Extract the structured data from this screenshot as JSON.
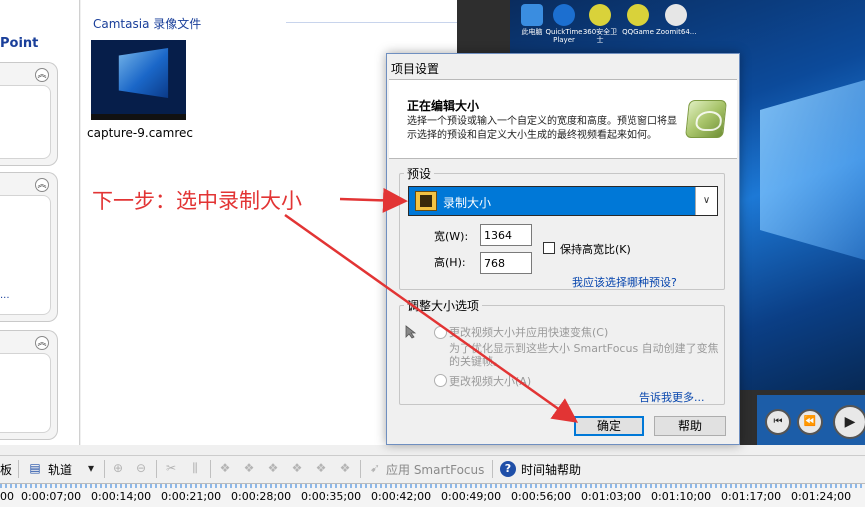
{
  "left_panel": {
    "title_fragment": "Point",
    "more_dots": "..."
  },
  "clip_bin": {
    "title": "Camtasia 录像文件",
    "clip_label": "capture-9.camrec"
  },
  "desktop_icons": [
    {
      "label": "此电脑"
    },
    {
      "label": "QuickTime Player"
    },
    {
      "label": "360安全卫士"
    },
    {
      "label": "QQGame"
    },
    {
      "label": "Zoomit64..."
    }
  ],
  "dialog": {
    "title": "项目设置",
    "header_title": "正在编辑大小",
    "header_desc": "选择一个预设或输入一个自定义的宽度和高度。预览窗口将显示选择的预设和自定义大小生成的最终视频看起来如何。",
    "preset_group": "预设",
    "preset_value": "录制大小",
    "width_label": "宽(W):",
    "width_value": "1364",
    "height_label": "高(H):",
    "height_value": "768",
    "keep_ratio_label": "保持高宽比(K)",
    "which_preset_link": "我应该选择哪种预设?",
    "adjust_group": "调整大小选项",
    "option_smartfocus": "更改视频大小并应用快速变焦(C)",
    "option_smartfocus_desc": "为了优化显示到这些大小 SmartFocus 自动创建了变焦的关键帧。",
    "option_resize": "更改视频大小(A)",
    "tell_more_link": "告诉我更多...",
    "ok_button": "确定",
    "help_button": "帮助"
  },
  "annotation": {
    "text": "下一步：选中录制大小"
  },
  "toolbar": {
    "left_fragment": "板",
    "track_label": "轨道",
    "apply_smartfocus": "应用 SmartFocus",
    "timeline_help": "时间轴帮助"
  },
  "ruler_ticks": [
    "00",
    "0:00:07;00",
    "0:00:14;00",
    "0:00:21;00",
    "0:00:28;00",
    "0:00:35;00",
    "0:00:42;00",
    "0:00:49;00",
    "0:00:56;00",
    "0:01:03;00",
    "0:01:10;00",
    "0:01:17;00",
    "0:01:24;00"
  ],
  "colors": {
    "accent_blue": "#0078d7",
    "annotation_red": "#e23434",
    "link_blue": "#0645ad"
  }
}
